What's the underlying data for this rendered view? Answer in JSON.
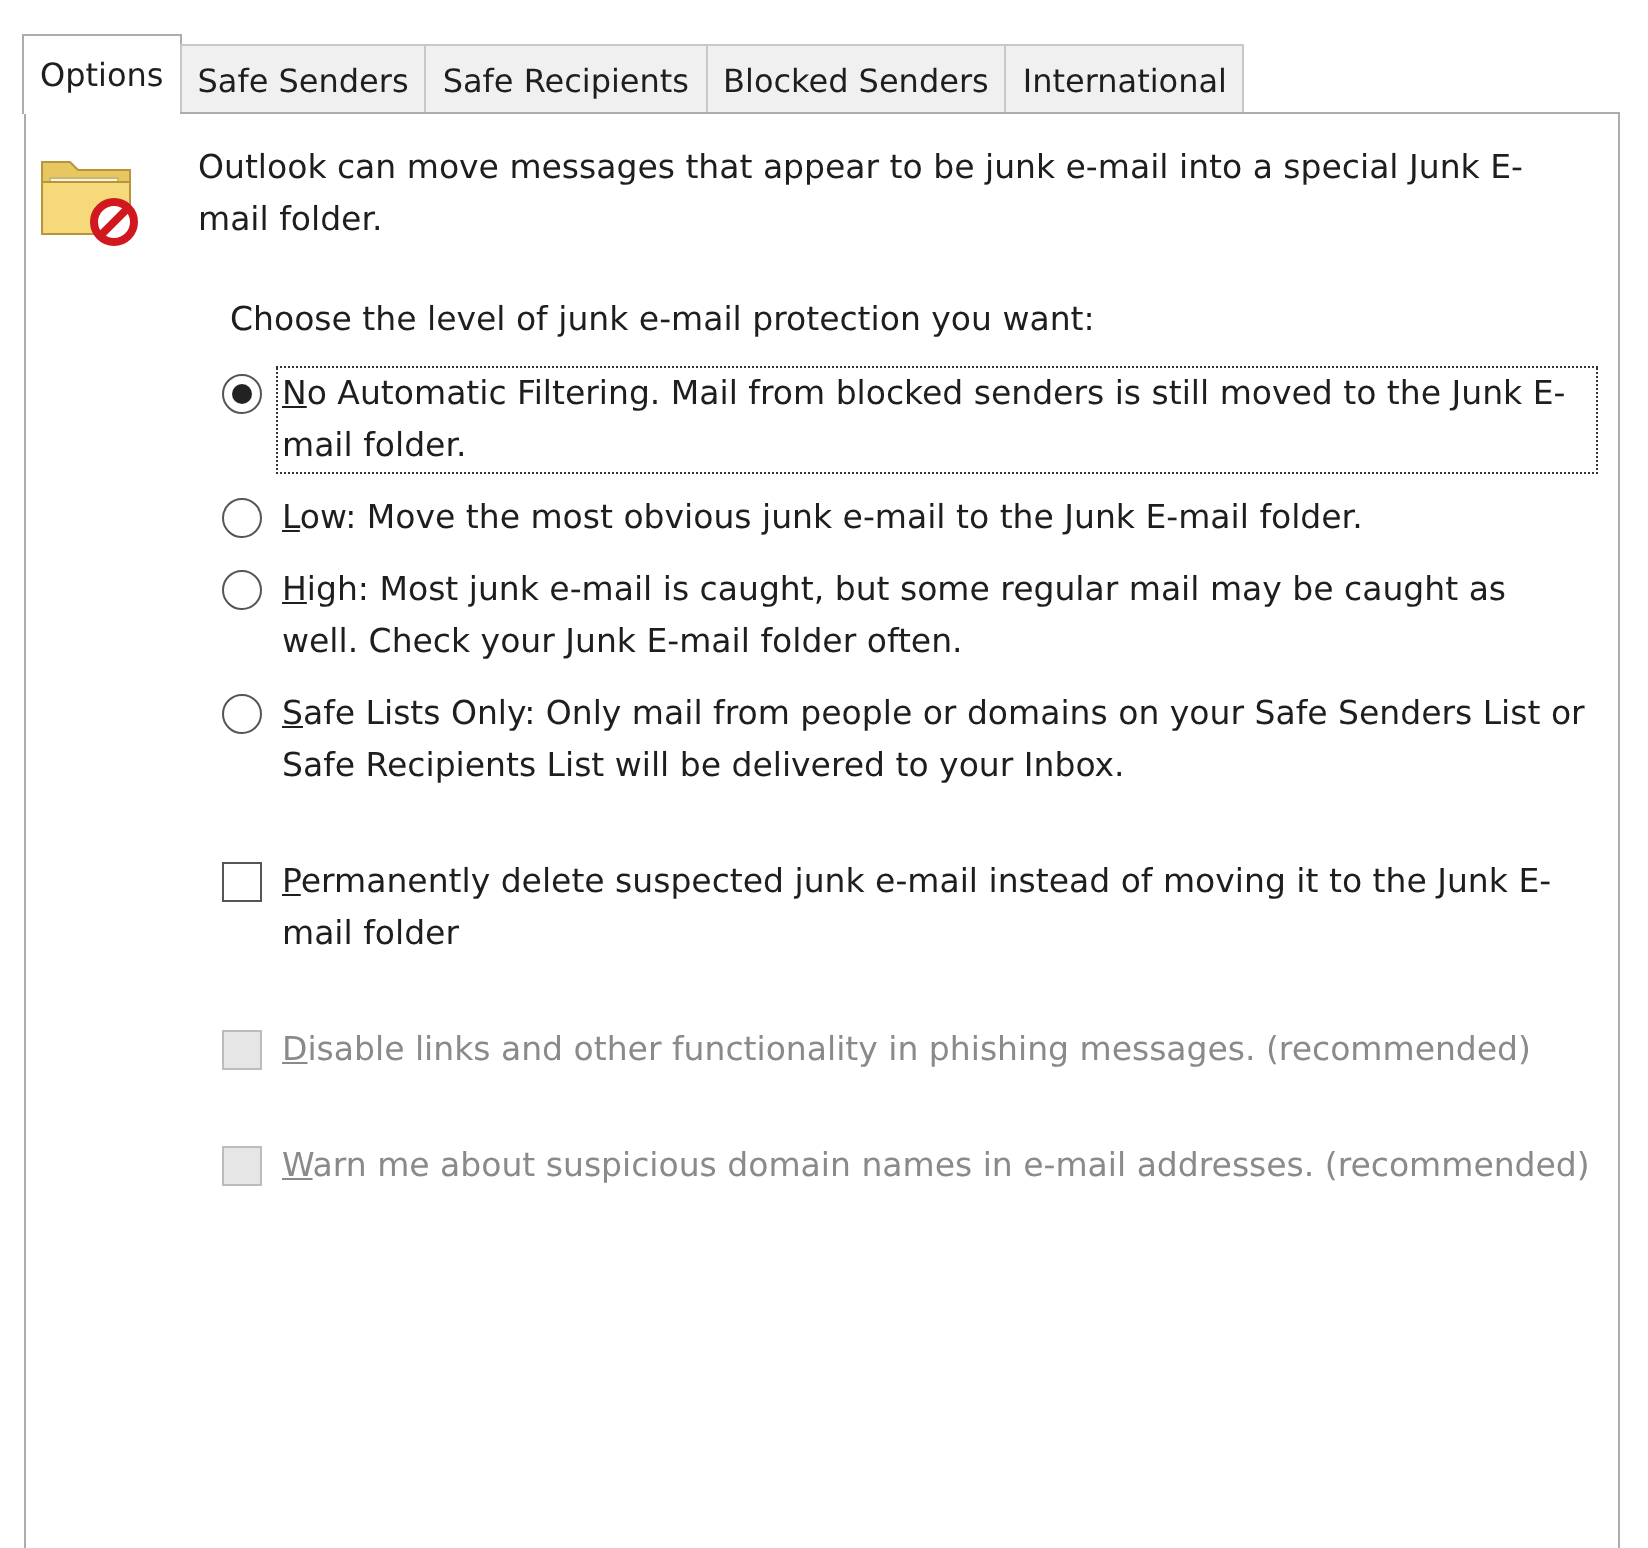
{
  "tabs": [
    {
      "label": "Options",
      "selected": true
    },
    {
      "label": "Safe Senders",
      "selected": false
    },
    {
      "label": "Safe Recipients",
      "selected": false
    },
    {
      "label": "Blocked Senders",
      "selected": false
    },
    {
      "label": "International",
      "selected": false
    }
  ],
  "intro": "Outlook can move messages that appear to be junk e-mail into a special Junk E-mail folder.",
  "prompt": "Choose the level of junk e-mail protection you want:",
  "levels": [
    {
      "label": "No Automatic Filtering. Mail from blocked senders is still moved to the Junk E-mail folder.",
      "selected": true,
      "focused": true,
      "mnemonic": true
    },
    {
      "label": "Low: Move the most obvious junk e-mail to the Junk E-mail folder.",
      "selected": false,
      "focused": false,
      "mnemonic": true
    },
    {
      "label": "High: Most junk e-mail is caught, but some regular mail may be caught as well. Check your Junk E-mail folder often.",
      "selected": false,
      "focused": false,
      "mnemonic": true
    },
    {
      "label": "Safe Lists Only: Only mail from people or domains on your Safe Senders List or Safe Recipients List will be delivered to your Inbox.",
      "selected": false,
      "focused": false,
      "mnemonic": true
    }
  ],
  "checkboxes": [
    {
      "label": "Permanently delete suspected junk e-mail instead of moving it to the Junk E-mail folder",
      "checked": false,
      "disabled": false,
      "mnemonic": true
    },
    {
      "label": "Disable links and other functionality in phishing messages. (recommended)",
      "checked": false,
      "disabled": true,
      "mnemonic": true
    },
    {
      "label": "Warn me about suspicious domain names in e-mail addresses. (recommended)",
      "checked": false,
      "disabled": true,
      "mnemonic": true
    }
  ]
}
